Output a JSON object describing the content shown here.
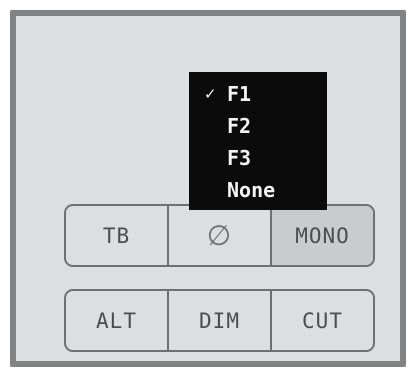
{
  "dropdown": {
    "selected_marker": "✓",
    "items": [
      {
        "label": "F1"
      },
      {
        "label": "F2"
      },
      {
        "label": "F3"
      },
      {
        "label": "None"
      }
    ]
  },
  "buttons": {
    "top_row": [
      "TB",
      "∅",
      "MONO"
    ],
    "bottom_row": [
      "ALT",
      "DIM",
      "CUT"
    ]
  },
  "icons": {
    "phase": "phase-invert-icon",
    "check": "checkmark-icon"
  },
  "colors": {
    "panel_bg": "#dcdedf",
    "panel_border": "#808284",
    "menu_bg": "#0b0b0b",
    "menu_text": "#f4f4f4",
    "button_text": "#4b4e50",
    "active_button_bg": "#c9cbcd"
  }
}
